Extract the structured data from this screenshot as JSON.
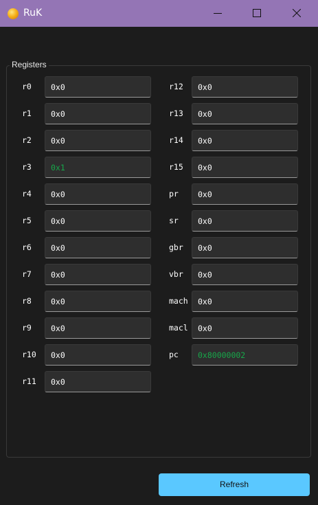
{
  "window": {
    "title": "RuK",
    "controls": [
      "minimize-icon",
      "maximize-icon",
      "close-icon"
    ]
  },
  "registers": {
    "group_title": "Registers",
    "left": [
      {
        "name": "r0",
        "value": "0x0"
      },
      {
        "name": "r1",
        "value": "0x0"
      },
      {
        "name": "r2",
        "value": "0x0"
      },
      {
        "name": "r3",
        "value": "0x1",
        "changed": true
      },
      {
        "name": "r4",
        "value": "0x0"
      },
      {
        "name": "r5",
        "value": "0x0"
      },
      {
        "name": "r6",
        "value": "0x0"
      },
      {
        "name": "r7",
        "value": "0x0"
      },
      {
        "name": "r8",
        "value": "0x0"
      },
      {
        "name": "r9",
        "value": "0x0"
      },
      {
        "name": "r10",
        "value": "0x0"
      },
      {
        "name": "r11",
        "value": "0x0"
      }
    ],
    "right": [
      {
        "name": "r12",
        "value": "0x0"
      },
      {
        "name": "r13",
        "value": "0x0"
      },
      {
        "name": "r14",
        "value": "0x0"
      },
      {
        "name": "r15",
        "value": "0x0"
      },
      {
        "name": "pr",
        "value": "0x0"
      },
      {
        "name": "sr",
        "value": "0x0"
      },
      {
        "name": "gbr",
        "value": "0x0"
      },
      {
        "name": "vbr",
        "value": "0x0"
      },
      {
        "name": "mach",
        "value": "0x0"
      },
      {
        "name": "macl",
        "value": "0x0"
      },
      {
        "name": "pc",
        "value": "0x80000002",
        "changed": true
      }
    ]
  },
  "actions": {
    "refresh_label": "Refresh"
  },
  "colors": {
    "titlebar": "#9475b5",
    "background": "#1c1c1c",
    "changed_value": "#17a84a",
    "refresh_button": "#5ac8ff"
  }
}
